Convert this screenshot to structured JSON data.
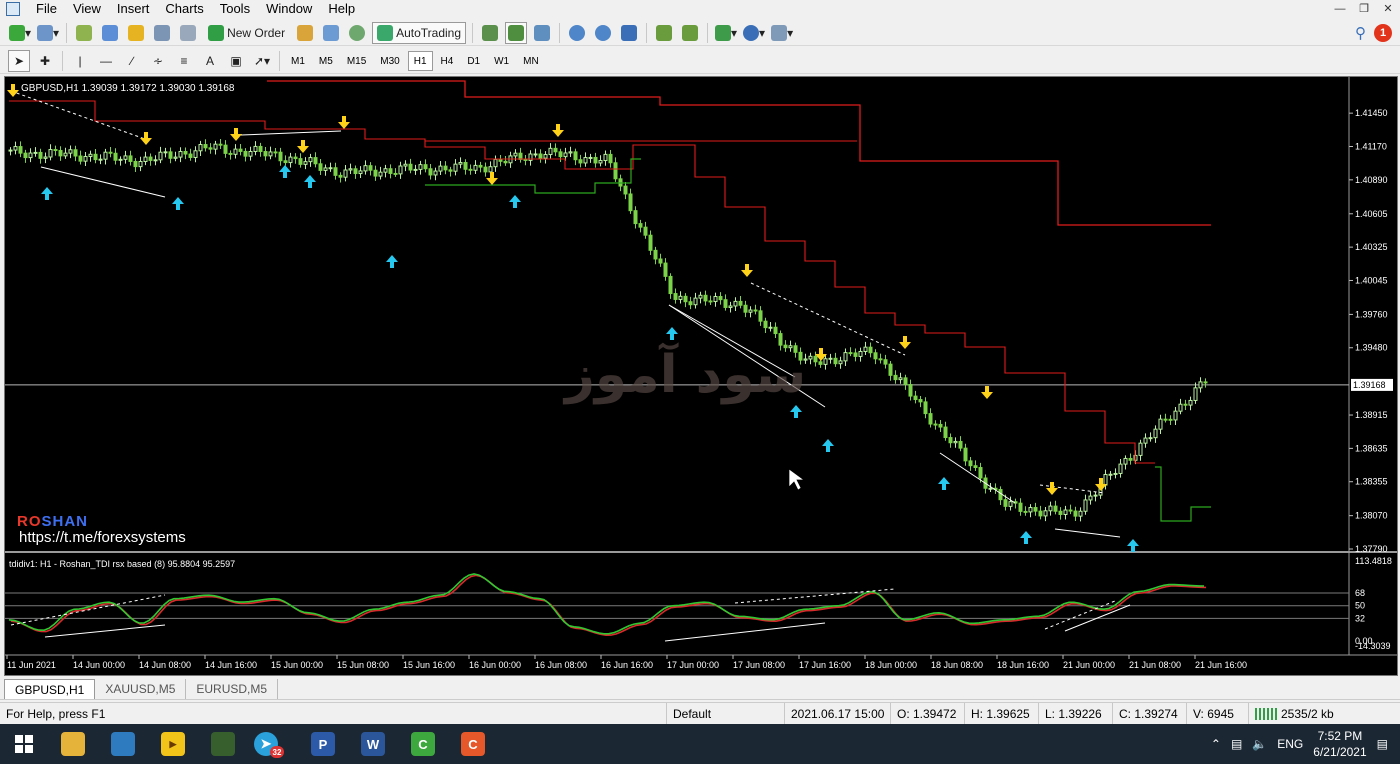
{
  "menu": {
    "items": [
      "File",
      "View",
      "Insert",
      "Charts",
      "Tools",
      "Window",
      "Help"
    ]
  },
  "toolbar": {
    "new_order": "New Order",
    "autotrading": "AutoTrading"
  },
  "timeframes": [
    "M1",
    "M5",
    "M15",
    "M30",
    "H1",
    "H4",
    "D1",
    "W1",
    "MN"
  ],
  "timeframe_selected": "H1",
  "notifications": {
    "count": "1"
  },
  "chart": {
    "title": "GBPUSD,H1  1.39039 1.39172 1.39030 1.39168",
    "current_price": "1.39168",
    "price_ticks": [
      "1.41450",
      "1.41170",
      "1.40890",
      "1.40605",
      "1.40325",
      "1.40045",
      "1.39760",
      "1.39480",
      "1.38915",
      "1.38635",
      "1.38355",
      "1.38070",
      "1.37790"
    ],
    "time_labels": [
      "11 Jun 2021",
      "14 Jun 00:00",
      "14 Jun 08:00",
      "14 Jun 16:00",
      "15 Jun 00:00",
      "15 Jun 08:00",
      "15 Jun 16:00",
      "16 Jun 00:00",
      "16 Jun 08:00",
      "16 Jun 16:00",
      "17 Jun 00:00",
      "17 Jun 08:00",
      "17 Jun 16:00",
      "18 Jun 00:00",
      "18 Jun 08:00",
      "18 Jun 16:00",
      "21 Jun 00:00",
      "21 Jun 08:00",
      "21 Jun 16:00"
    ],
    "brand_ro": "RO",
    "brand_shan": "SHAN",
    "brand_url": "https://t.me/forexsystems",
    "watermark": "سود آموز",
    "indicator_title": "tdidiv1: H1 - Roshan_TDI rsx based (8) 95.8804 95.2597",
    "indicator_ticks": [
      "113.4818",
      "68",
      "50",
      "32",
      "0.00",
      "-14.3039"
    ]
  },
  "chart_data": {
    "type": "line",
    "title": "GBPUSD,H1  1.39039 1.39172 1.39030 1.39168",
    "x": [
      "11 Jun 2021",
      "14 Jun 00:00",
      "14 Jun 08:00",
      "14 Jun 16:00",
      "15 Jun 00:00",
      "15 Jun 08:00",
      "15 Jun 16:00",
      "16 Jun 00:00",
      "16 Jun 08:00",
      "16 Jun 16:00",
      "17 Jun 00:00",
      "17 Jun 08:00",
      "17 Jun 16:00",
      "18 Jun 00:00",
      "18 Jun 08:00",
      "18 Jun 16:00",
      "21 Jun 00:00",
      "21 Jun 08:00",
      "21 Jun 16:00"
    ],
    "series": [
      {
        "name": "",
        "values": [
          1.4112,
          1.411,
          1.4105,
          1.4116,
          1.411,
          1.4095,
          1.4098,
          1.4099,
          1.4112,
          1.4105,
          1.399,
          1.3985,
          1.3935,
          1.3945,
          1.388,
          1.3815,
          1.3808,
          1.3865,
          1.392
        ]
      }
    ],
    "ylim": [
      1.3779,
      1.4172
    ],
    "xlabel": "",
    "ylabel": ""
  },
  "tabs": [
    "GBPUSD,H1",
    "XAUUSD,M5",
    "EURUSD,M5"
  ],
  "tab_active": "GBPUSD,H1",
  "status": {
    "help": "For Help, press F1",
    "profile": "Default",
    "datetime": "2021.06.17 15:00",
    "open": "O: 1.39472",
    "high": "H: 1.39625",
    "low": "L: 1.39226",
    "close": "C: 1.39274",
    "volume": "V: 6945",
    "traffic": "2535/2 kb"
  },
  "taskbar": {
    "lang": "ENG",
    "time": "7:52 PM",
    "date": "6/21/2021",
    "telegram_badge": "32"
  },
  "colors": {
    "bull": "#b9f0a0",
    "bear": "#7bd34a",
    "resistance": "#e01c1c",
    "support": "#2ea81f",
    "arrow_up": "#27c8f0",
    "arrow_down": "#ffd21a",
    "tdi_red": "#d62b2b",
    "tdi_green": "#32c832"
  }
}
